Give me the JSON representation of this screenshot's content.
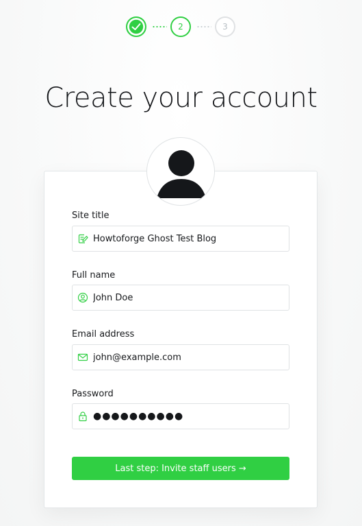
{
  "steps": {
    "step2": "2",
    "step3": "3"
  },
  "title": "Create your account",
  "form": {
    "site_title": {
      "label": "Site title",
      "value": "Howtoforge Ghost Test Blog"
    },
    "full_name": {
      "label": "Full name",
      "value": "John Doe"
    },
    "email": {
      "label": "Email address",
      "value": "john@example.com"
    },
    "password": {
      "label": "Password",
      "value": "●●●●●●●●●●"
    }
  },
  "button": {
    "label": "Last step: Invite staff users →"
  },
  "colors": {
    "accent": "#30cf43",
    "border": "#dfe2e4",
    "text": "#15171a"
  },
  "icons": {
    "step1": "check-icon",
    "site_title": "pencil-note-icon",
    "full_name": "user-circle-icon",
    "email": "envelope-icon",
    "password": "lock-icon",
    "avatar": "user-silhouette-icon"
  }
}
